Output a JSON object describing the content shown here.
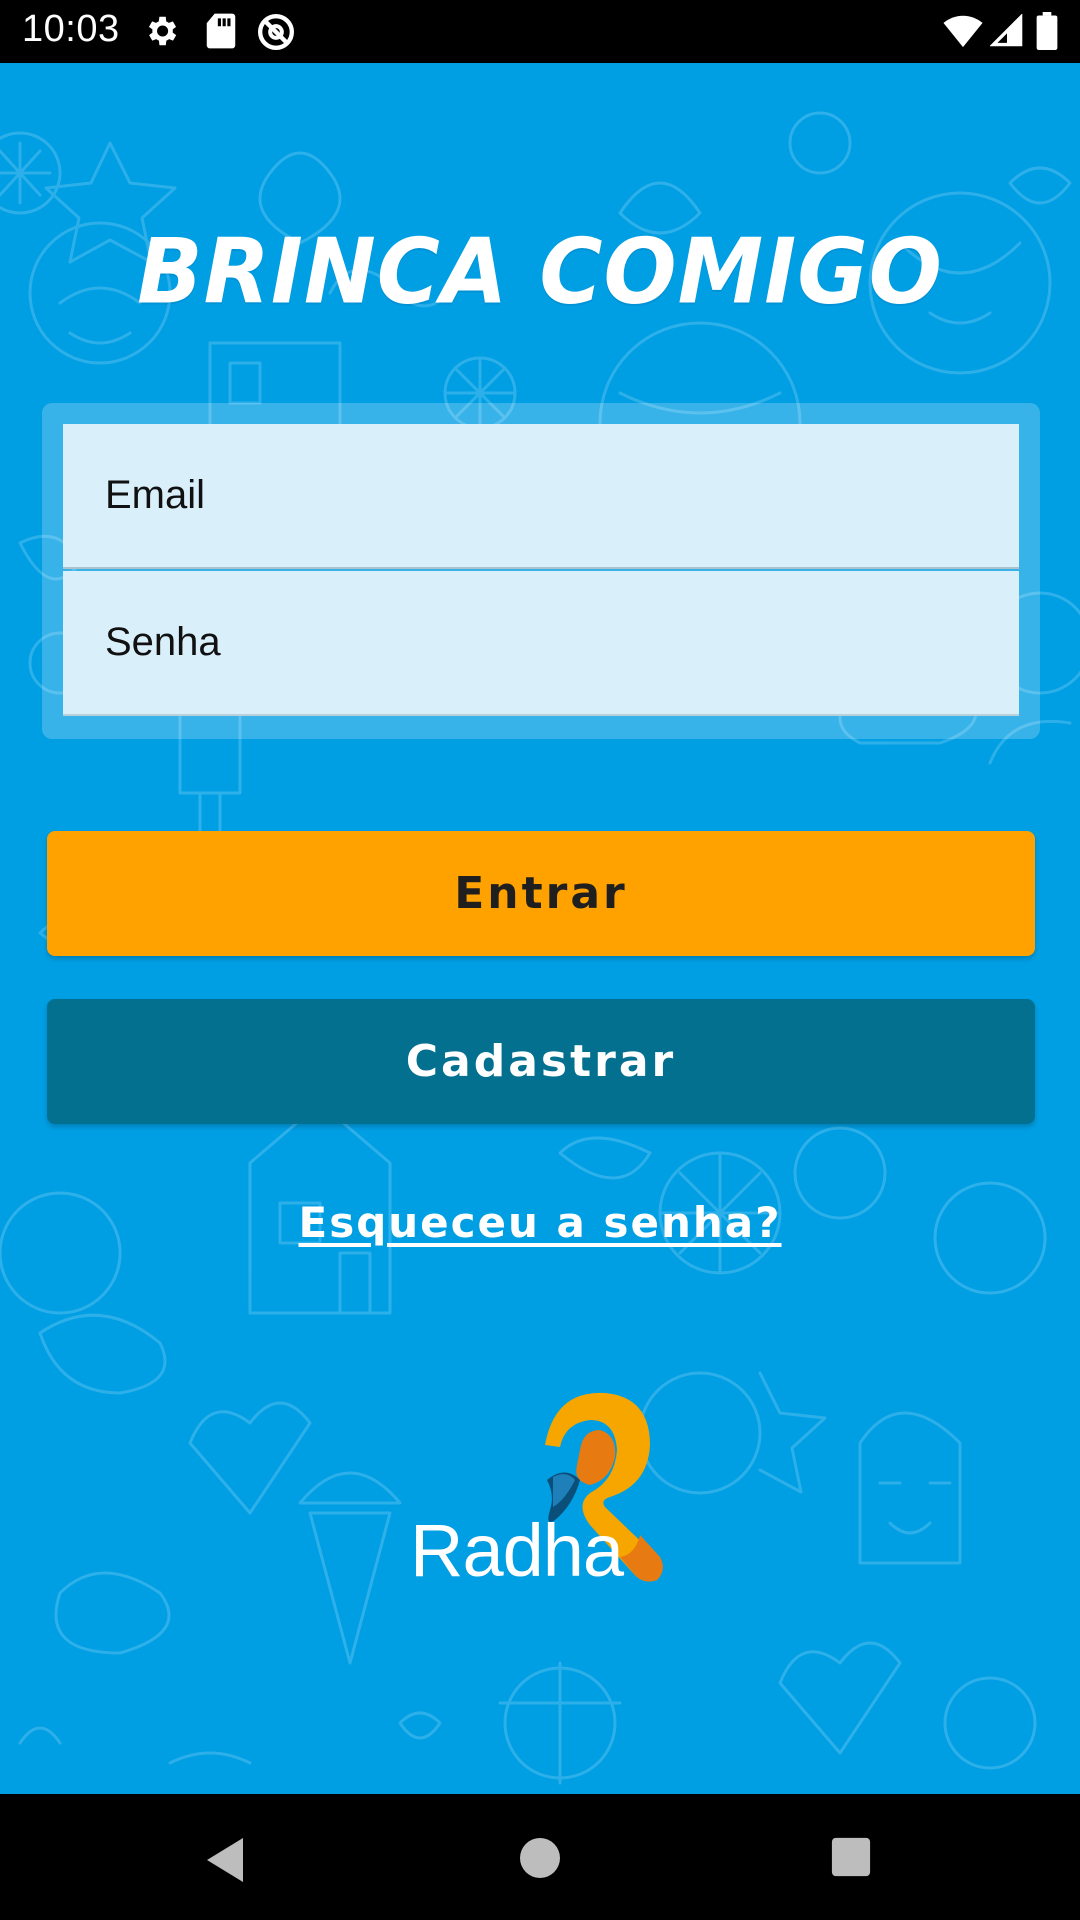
{
  "status_bar": {
    "time": "10:03",
    "icons": [
      "settings-icon",
      "sd-card-icon",
      "do-not-disturb-icon",
      "wifi-icon",
      "cell-signal-icon",
      "battery-icon"
    ]
  },
  "app": {
    "title": "BRINCA COMIGO",
    "background_color": "#009ee3"
  },
  "login_form": {
    "email_placeholder": "Email",
    "email_value": "",
    "password_placeholder": "Senha",
    "password_value": ""
  },
  "actions": {
    "login_label": "Entrar",
    "login_color": "#ffa200",
    "register_label": "Cadastrar",
    "register_color": "#03708f",
    "forgot_password_label": "Esqueceu a senha?"
  },
  "brand": {
    "name": "Radha",
    "logo_icon": "radha-r-logo-icon"
  },
  "nav_bar": {
    "icons": [
      "back-icon",
      "home-icon",
      "recents-icon"
    ]
  }
}
